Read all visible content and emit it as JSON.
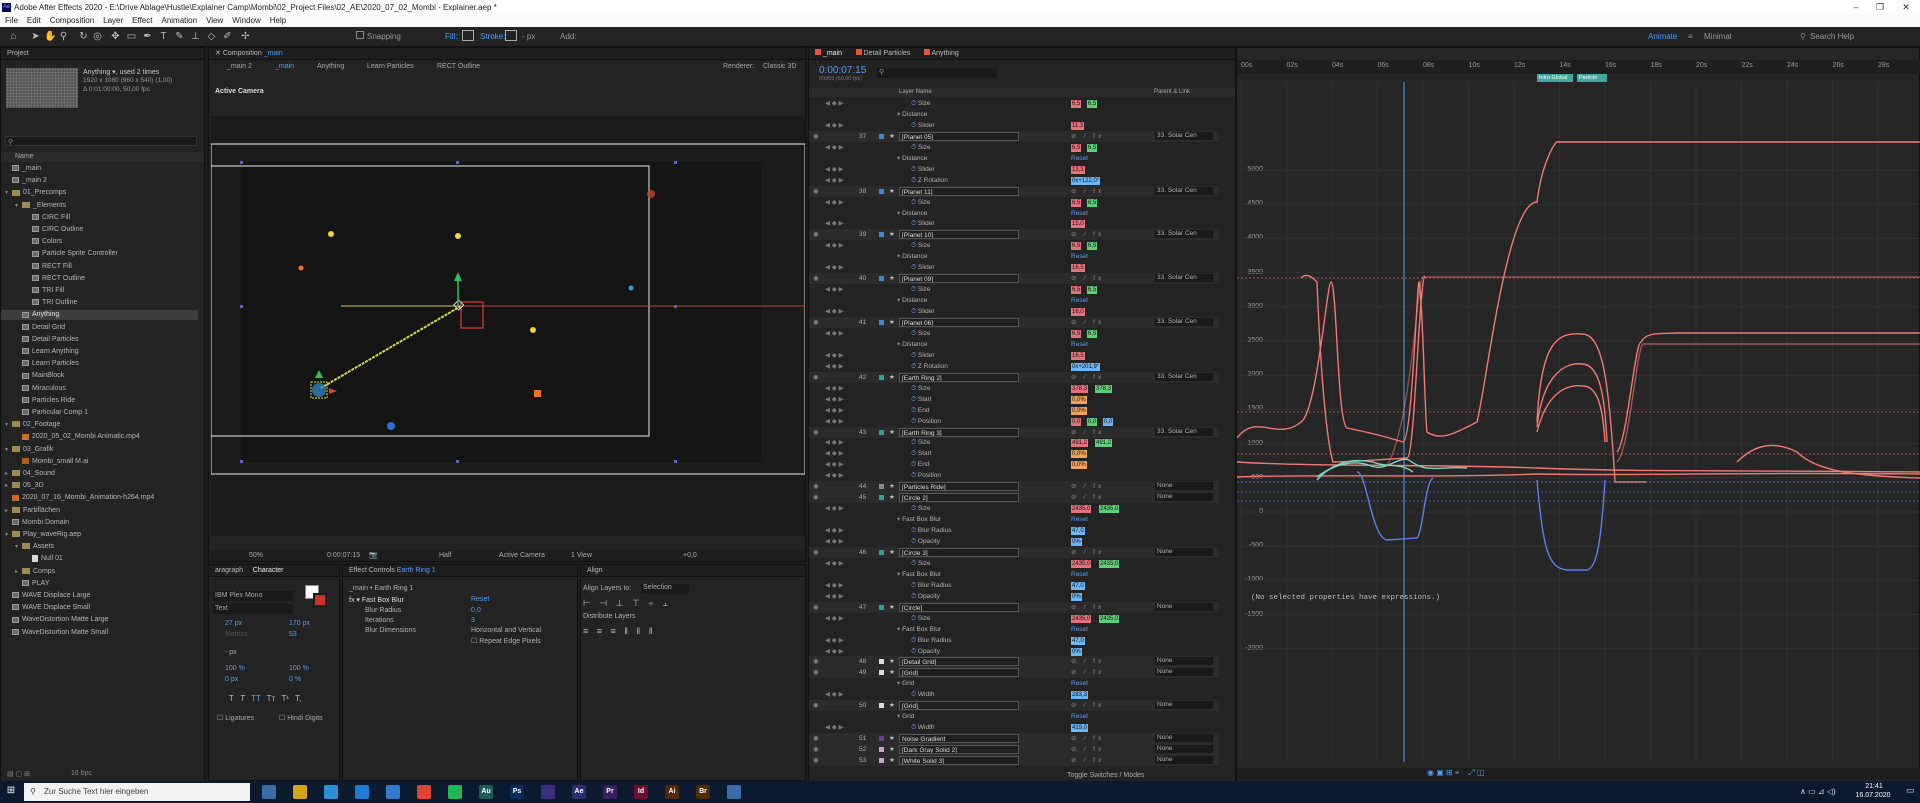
{
  "window": {
    "title": "Adobe After Effects 2020 - E:\\Drive Ablage\\Hustle\\Explainer Camp\\Mombi\\02_Project Files\\02_AE\\2020_07_02_Mombi - Explainer.aep *",
    "app_icon_text": "Ae",
    "minimize": "–",
    "maximize": "❐",
    "close": "✕"
  },
  "menu": [
    "File",
    "Edit",
    "Composition",
    "Layer",
    "Effect",
    "Animation",
    "View",
    "Window",
    "Help"
  ],
  "toolbar": {
    "snapping": "Snapping",
    "fill": "Fill:",
    "stroke": "Stroke:",
    "stroke_px": "-  px",
    "add": "Add:",
    "workspaces": [
      "Animate",
      "Minimal"
    ],
    "search_placeholder": "Search Help"
  },
  "project": {
    "tab": "Project",
    "selected_name": "Anything ▾, used 2 times",
    "selected_size": "1920 x 1080 (960 x 540) (1,00)",
    "selected_duration": "Δ 0:01:00:00, 50,00 fps",
    "search_placeholder": "",
    "column_name": "Name",
    "items": [
      {
        "type": "comp",
        "indent": 0,
        "label": "_main"
      },
      {
        "type": "comp",
        "indent": 0,
        "label": "_main 2"
      },
      {
        "type": "folder",
        "indent": 0,
        "label": "01_Precomps",
        "open": true
      },
      {
        "type": "folder",
        "indent": 1,
        "label": "_Elements",
        "open": true
      },
      {
        "type": "comp",
        "indent": 2,
        "label": "CIRC Fill"
      },
      {
        "type": "comp",
        "indent": 2,
        "label": "CIRC Outline"
      },
      {
        "type": "comp",
        "indent": 2,
        "label": "Colors"
      },
      {
        "type": "comp",
        "indent": 2,
        "label": "Particle Sprite Controller"
      },
      {
        "type": "comp",
        "indent": 2,
        "label": "RECT Fill"
      },
      {
        "type": "comp",
        "indent": 2,
        "label": "RECT Outline"
      },
      {
        "type": "comp",
        "indent": 2,
        "label": "TRI Fill"
      },
      {
        "type": "comp",
        "indent": 2,
        "label": "TRI Outline"
      },
      {
        "type": "comp",
        "indent": 1,
        "label": "Anything",
        "selected": true
      },
      {
        "type": "comp",
        "indent": 1,
        "label": "Detail Grid"
      },
      {
        "type": "comp",
        "indent": 1,
        "label": "Detail Particles"
      },
      {
        "type": "comp",
        "indent": 1,
        "label": "Learn Anything"
      },
      {
        "type": "comp",
        "indent": 1,
        "label": "Learn Particles"
      },
      {
        "type": "comp",
        "indent": 1,
        "label": "MainBlock"
      },
      {
        "type": "comp",
        "indent": 1,
        "label": "Miraculous"
      },
      {
        "type": "comp",
        "indent": 1,
        "label": "Particles Ride"
      },
      {
        "type": "comp",
        "indent": 1,
        "label": "Particular Comp 1"
      },
      {
        "type": "folder",
        "indent": 0,
        "label": "02_Footage",
        "open": true
      },
      {
        "type": "footage",
        "indent": 1,
        "label": "2020_05_02_Mombi Animatic.mp4"
      },
      {
        "type": "folder",
        "indent": 0,
        "label": "03_Grafik",
        "open": true
      },
      {
        "type": "ai",
        "indent": 1,
        "label": "Mombi_small M.ai"
      },
      {
        "type": "folder",
        "indent": 0,
        "label": "04_Sound"
      },
      {
        "type": "folder",
        "indent": 0,
        "label": "05_3D"
      },
      {
        "type": "footage",
        "indent": 0,
        "label": "2020_07_16_Mombi_Animation-h264.mp4"
      },
      {
        "type": "folder",
        "indent": 0,
        "label": "Farbflächen"
      },
      {
        "type": "comp",
        "indent": 0,
        "label": "Mombi Domain"
      },
      {
        "type": "folder",
        "indent": 0,
        "label": "Play_waveRig.aep",
        "open": true
      },
      {
        "type": "folder",
        "indent": 1,
        "label": "Assets",
        "open": true
      },
      {
        "type": "file",
        "indent": 2,
        "label": "Null 01"
      },
      {
        "type": "folder",
        "indent": 1,
        "label": "Comps"
      },
      {
        "type": "comp",
        "indent": 1,
        "label": "PLAY"
      },
      {
        "type": "comp",
        "indent": 0,
        "label": "WAVE Displace Large"
      },
      {
        "type": "comp",
        "indent": 0,
        "label": "WAVE Displace Small"
      },
      {
        "type": "comp",
        "indent": 0,
        "label": "WaveDistortion Matte Large"
      },
      {
        "type": "comp",
        "indent": 0,
        "label": "WaveDistortion Matte Small"
      }
    ],
    "bpc": "16 bpc"
  },
  "composition": {
    "tab": "Composition",
    "tab_name": "_main",
    "breadcrumbs": [
      "_main 2",
      "_main",
      "Anything",
      "Learn Particles",
      "RECT Outline"
    ],
    "renderer_label": "Renderer:",
    "renderer": "Classic 3D",
    "camera_label": "Active Camera",
    "footer": {
      "zoom": "50%",
      "time": "0:00:07:15",
      "resolution": "Half",
      "view": "Active Camera",
      "views": "1 View",
      "exposure": "+0,0"
    }
  },
  "character": {
    "tabs": [
      "aragraph",
      "Character"
    ],
    "font": "IBM Plex Mono",
    "style": "Text",
    "size": "27 px",
    "leading": "170 px",
    "kerning": "Metrics",
    "tracking": "53",
    "stroke": "-  px",
    "vscale": "100 %",
    "hscale": "100 %",
    "baseline": "0 px",
    "tsume": "0 %",
    "styles": [
      "T",
      "T",
      "TT",
      "Tт",
      "T¹",
      "T,"
    ],
    "ligatures": "Ligatures",
    "hindi": "Hindi Digits"
  },
  "effect_controls": {
    "tab": "Effect Controls",
    "tab_layer": "Earth Ring 1",
    "layer_path": "_main • Earth Ring 1",
    "effect": "Fast Box Blur",
    "reset": "Reset",
    "rows": [
      {
        "label": "Blur Radius",
        "value": "0,0"
      },
      {
        "label": "Iterations",
        "value": "3"
      },
      {
        "label": "Blur Dimensions",
        "value": "Horizontal and Vertical"
      }
    ],
    "repeat_edge": "Repeat Edge Pixels"
  },
  "align": {
    "tab": "Align",
    "align_to_label": "Align Layers to:",
    "align_to": "Selection",
    "distribute_label": "Distribute Layers"
  },
  "timeline": {
    "tabs": [
      "_main",
      "Detail Particles",
      "Anything"
    ],
    "timecode": "0:00:07:15",
    "frames": "00365 (50.00 fps)",
    "col_layer": "Layer Name",
    "col_parent": "Parent & Link",
    "toggle": "Toggle Switches / Modes",
    "rows": [
      {
        "t": "prop",
        "label": "Size",
        "indent": 3,
        "vals": [
          [
            "v-red",
            "6,5"
          ],
          [
            "v-green",
            "6,5"
          ]
        ]
      },
      {
        "t": "group",
        "label": "Distance",
        "indent": 2
      },
      {
        "t": "prop",
        "label": "Slider",
        "indent": 3,
        "vals": [
          [
            "v-red",
            "11,3"
          ]
        ]
      },
      {
        "t": "layer",
        "num": "37",
        "label": "[Planet 05]",
        "color": "#3e86d8",
        "parent": "33. Solar Cen"
      },
      {
        "t": "prop",
        "label": "Size",
        "indent": 3,
        "vals": [
          [
            "v-red",
            "6,5"
          ],
          [
            "v-green",
            "6,5"
          ]
        ]
      },
      {
        "t": "group",
        "label": "Distance",
        "indent": 2,
        "reset": true
      },
      {
        "t": "prop",
        "label": "Slider",
        "indent": 3,
        "vals": [
          [
            "v-red",
            "13,3"
          ]
        ]
      },
      {
        "t": "prop",
        "label": "Z Rotation",
        "indent": 3,
        "vals": [
          [
            "v-blue",
            "0x+122,0°"
          ]
        ]
      },
      {
        "t": "layer",
        "num": "38",
        "label": "[Planet 11]",
        "color": "#3e86d8",
        "parent": "33. Solar Cen"
      },
      {
        "t": "prop",
        "label": "Size",
        "indent": 3,
        "vals": [
          [
            "v-red",
            "6,5"
          ],
          [
            "v-green",
            "6,5"
          ]
        ]
      },
      {
        "t": "group",
        "label": "Distance",
        "indent": 2,
        "reset": true
      },
      {
        "t": "prop",
        "label": "Slider",
        "indent": 3,
        "vals": [
          [
            "v-red",
            "15,0"
          ]
        ]
      },
      {
        "t": "layer",
        "num": "39",
        "label": "[Planet 10]",
        "color": "#3e86d8",
        "parent": "33. Solar Cen"
      },
      {
        "t": "prop",
        "label": "Size",
        "indent": 3,
        "vals": [
          [
            "v-red",
            "6,5"
          ],
          [
            "v-green",
            "6,5"
          ]
        ]
      },
      {
        "t": "group",
        "label": "Distance",
        "indent": 2,
        "reset": true
      },
      {
        "t": "prop",
        "label": "Slider",
        "indent": 3,
        "vals": [
          [
            "v-red",
            "16,5"
          ]
        ]
      },
      {
        "t": "layer",
        "num": "40",
        "label": "[Planet 09]",
        "color": "#3e86d8",
        "parent": "33. Solar Cen"
      },
      {
        "t": "prop",
        "label": "Size",
        "indent": 3,
        "vals": [
          [
            "v-red",
            "6,5"
          ],
          [
            "v-green",
            "6,5"
          ]
        ]
      },
      {
        "t": "group",
        "label": "Distance",
        "indent": 2,
        "reset": true
      },
      {
        "t": "prop",
        "label": "Slider",
        "indent": 3,
        "vals": [
          [
            "v-red",
            "16,0"
          ]
        ]
      },
      {
        "t": "layer",
        "num": "41",
        "label": "[Planet 06]",
        "color": "#3e86d8",
        "parent": "33. Solar Cen"
      },
      {
        "t": "prop",
        "label": "Size",
        "indent": 3,
        "vals": [
          [
            "v-red",
            "6,5"
          ],
          [
            "v-green",
            "6,5"
          ]
        ]
      },
      {
        "t": "group",
        "label": "Distance",
        "indent": 2,
        "reset": true
      },
      {
        "t": "prop",
        "label": "Slider",
        "indent": 3,
        "vals": [
          [
            "v-red",
            "16,5"
          ]
        ]
      },
      {
        "t": "prop",
        "label": "Z Rotation",
        "indent": 3,
        "vals": [
          [
            "v-blue",
            "0x+201,9°"
          ]
        ]
      },
      {
        "t": "layer",
        "num": "42",
        "label": "[Earth Ring 2]",
        "color": "#2aa59a",
        "parent": "33. Solar Cen"
      },
      {
        "t": "prop",
        "label": "Size",
        "indent": 3,
        "vals": [
          [
            "v-red",
            "378,3"
          ],
          [
            "v-green",
            "378,3"
          ]
        ]
      },
      {
        "t": "prop",
        "label": "Start",
        "indent": 3,
        "vals": [
          [
            "v-orange",
            "0,0%"
          ]
        ]
      },
      {
        "t": "prop",
        "label": "End",
        "indent": 3,
        "vals": [
          [
            "v-orange",
            "0,0%"
          ]
        ]
      },
      {
        "t": "prop",
        "label": "Position",
        "indent": 3,
        "vals": [
          [
            "v-red",
            "0,0"
          ],
          [
            "v-green",
            "0,0"
          ],
          [
            "v-blue",
            "0,0"
          ]
        ]
      },
      {
        "t": "layer",
        "num": "43",
        "label": "[Earth Ring 3]",
        "color": "#2aa59a",
        "parent": "33. Solar Cen"
      },
      {
        "t": "prop",
        "label": "Size",
        "indent": 3,
        "vals": [
          [
            "v-red",
            "491,2"
          ],
          [
            "v-green",
            "491,2"
          ]
        ]
      },
      {
        "t": "prop",
        "label": "Start",
        "indent": 3,
        "vals": [
          [
            "v-orange",
            "0,0%"
          ]
        ]
      },
      {
        "t": "prop",
        "label": "End",
        "indent": 3,
        "vals": [
          [
            "v-orange",
            "0,0%"
          ]
        ]
      },
      {
        "t": "prop",
        "label": "Position",
        "indent": 3,
        "vals": []
      },
      {
        "t": "layer",
        "num": "44",
        "label": "[Particles Ride]",
        "color": "#8a8a8a",
        "parent": "None"
      },
      {
        "t": "layer",
        "num": "45",
        "label": "[Circle 2]",
        "color": "#2aa59a",
        "parent": "None"
      },
      {
        "t": "prop",
        "label": "Size",
        "indent": 3,
        "vals": [
          [
            "v-red",
            "2435,0"
          ],
          [
            "v-green",
            "2435,0"
          ]
        ]
      },
      {
        "t": "group",
        "label": "Fast Box Blur",
        "indent": 2,
        "reset": true
      },
      {
        "t": "prop",
        "label": "Blur Radius",
        "indent": 3,
        "vals": [
          [
            "v-blue",
            "47,0"
          ]
        ]
      },
      {
        "t": "prop",
        "label": "Opacity",
        "indent": 3,
        "vals": [
          [
            "v-blue",
            "0%"
          ]
        ]
      },
      {
        "t": "layer",
        "num": "46",
        "label": "[Circle 3]",
        "color": "#2aa59a",
        "parent": "None"
      },
      {
        "t": "prop",
        "label": "Size",
        "indent": 3,
        "vals": [
          [
            "v-red",
            "2435,0"
          ],
          [
            "v-green",
            "2435,0"
          ]
        ]
      },
      {
        "t": "group",
        "label": "Fast Box Blur",
        "indent": 2,
        "reset": true
      },
      {
        "t": "prop",
        "label": "Blur Radius",
        "indent": 3,
        "vals": [
          [
            "v-blue",
            "47,0"
          ]
        ]
      },
      {
        "t": "prop",
        "label": "Opacity",
        "indent": 3,
        "vals": [
          [
            "v-blue",
            "0%"
          ]
        ]
      },
      {
        "t": "layer",
        "num": "47",
        "label": "[Circle]",
        "color": "#2aa59a",
        "parent": "None"
      },
      {
        "t": "prop",
        "label": "Size",
        "indent": 3,
        "vals": [
          [
            "v-red",
            "2435,0"
          ],
          [
            "v-green",
            "2435,0"
          ]
        ]
      },
      {
        "t": "group",
        "label": "Fast Box Blur",
        "indent": 2,
        "reset": true
      },
      {
        "t": "prop",
        "label": "Blur Radius",
        "indent": 3,
        "vals": [
          [
            "v-blue",
            "47,0"
          ]
        ]
      },
      {
        "t": "prop",
        "label": "Opacity",
        "indent": 3,
        "vals": [
          [
            "v-blue",
            "0%"
          ]
        ]
      },
      {
        "t": "layer",
        "num": "48",
        "label": "[Detail Grid]",
        "color": "#dddddd",
        "parent": "None"
      },
      {
        "t": "layer",
        "num": "49",
        "label": "[Grid]",
        "color": "#dddddd",
        "parent": "None"
      },
      {
        "t": "group",
        "label": "Grid",
        "indent": 2,
        "reset": true
      },
      {
        "t": "prop",
        "label": "Width",
        "indent": 3,
        "vals": [
          [
            "v-blue",
            "283,3"
          ]
        ]
      },
      {
        "t": "layer",
        "num": "50",
        "label": "[Grid]",
        "color": "#dddddd",
        "parent": "None"
      },
      {
        "t": "group",
        "label": "Grid",
        "indent": 2,
        "reset": true
      },
      {
        "t": "prop",
        "label": "Width",
        "indent": 3,
        "vals": [
          [
            "v-blue",
            "419,0"
          ]
        ]
      },
      {
        "t": "layer",
        "num": "51",
        "label": "Noise Gradient",
        "color": "#6b3b99",
        "parent": "None"
      },
      {
        "t": "layer",
        "num": "52",
        "label": "[Dark Gray Solid 2]",
        "color": "#c9a4c7",
        "parent": "None"
      },
      {
        "t": "layer",
        "num": "53",
        "label": "[White Solid 3]",
        "color": "#c9a4c7",
        "parent": "None"
      }
    ]
  },
  "graph": {
    "ruler": [
      "00s",
      "02s",
      "04s",
      "06s",
      "08s",
      "10s",
      "12s",
      "14s",
      "16s",
      "18s",
      "20s",
      "22s",
      "24s",
      "26s",
      "28s"
    ],
    "markers": [
      "Intro Global",
      "Particle"
    ],
    "y_labels": [
      "5000",
      "4500",
      "4000",
      "3500",
      "3000",
      "2500",
      "2000",
      "1500",
      "1000",
      "500",
      "0",
      "-500",
      "-1000",
      "-1500",
      "-2000"
    ],
    "expression_text": "(No selected properties have expressions.)"
  },
  "taskbar": {
    "search_placeholder": "Zur Suche Text hier eingeben",
    "apps": [
      {
        "label": "",
        "color": "#3a6ea5"
      },
      {
        "label": "",
        "color": "#d6a31d"
      },
      {
        "label": "",
        "color": "#2b8fd6"
      },
      {
        "label": "",
        "color": "#1f7bd6"
      },
      {
        "label": "",
        "color": "#2e7bd0"
      },
      {
        "label": "",
        "color": "#de4431"
      },
      {
        "label": "",
        "color": "#1db954"
      },
      {
        "label": "Au",
        "color": "#1f5c57"
      },
      {
        "label": "Ps",
        "color": "#0b2a5b"
      },
      {
        "label": "",
        "color": "#3a2f7a"
      },
      {
        "label": "Ae",
        "color": "#2e2d6e"
      },
      {
        "label": "Pr",
        "color": "#3a1f5e"
      },
      {
        "label": "Id",
        "color": "#6b0f2f"
      },
      {
        "label": "Ai",
        "color": "#4e2a05"
      },
      {
        "label": "Br",
        "color": "#4a2d05"
      },
      {
        "label": "",
        "color": "#3b6ea8"
      }
    ],
    "time": "21:41",
    "date": "16.07.2020"
  },
  "colors": {
    "accent": "#4f9ef7",
    "ui_bg": "#232323",
    "curve_red": "#f07a73",
    "curve_blue": "#5d7de8",
    "curve_teal": "#7ed4c1"
  }
}
